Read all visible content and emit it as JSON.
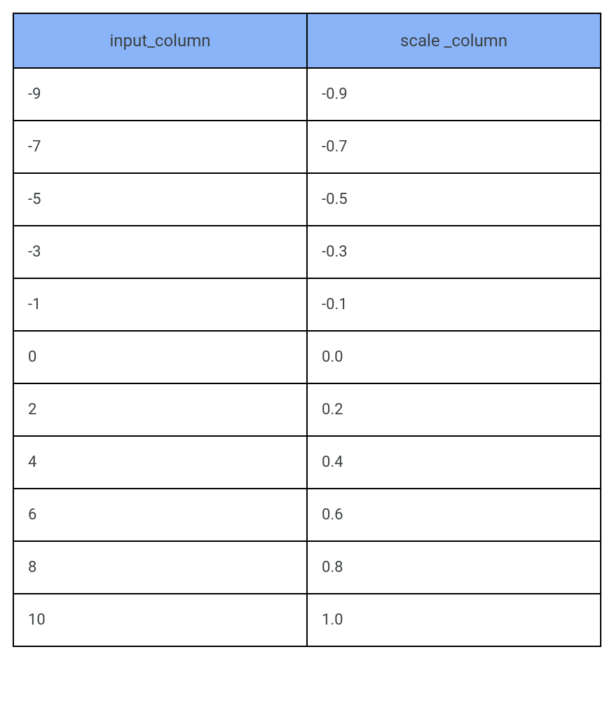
{
  "chart_data": {
    "type": "table",
    "columns": [
      "input_column",
      "scale _column"
    ],
    "rows": [
      [
        "-9",
        "-0.9"
      ],
      [
        "-7",
        "-0.7"
      ],
      [
        "-5",
        "-0.5"
      ],
      [
        "-3",
        "-0.3"
      ],
      [
        "-1",
        "-0.1"
      ],
      [
        "0",
        "0.0"
      ],
      [
        "2",
        "0.2"
      ],
      [
        "4",
        "0.4"
      ],
      [
        "6",
        "0.6"
      ],
      [
        "8",
        "0.8"
      ],
      [
        "10",
        "1.0"
      ]
    ]
  }
}
